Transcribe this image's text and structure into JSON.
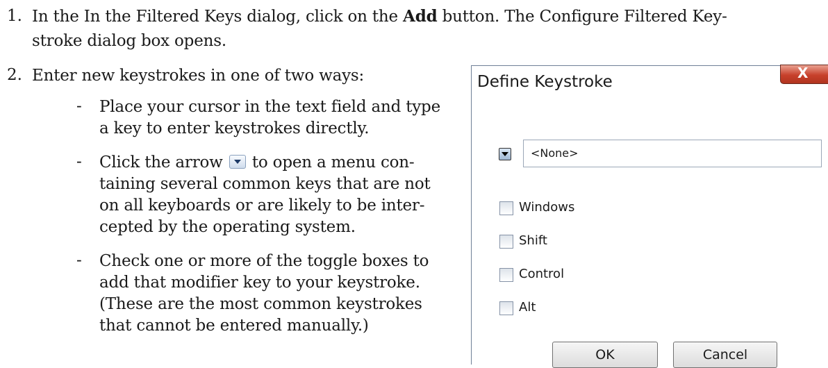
{
  "instructions": {
    "step1": {
      "number": "1.",
      "text_a": "In the In the Filtered Keys dialog, click on the ",
      "bold": "Add",
      "text_b": " button. The Configure Filtered Key-",
      "text_c": "stroke dialog box opens."
    },
    "step2": {
      "number": "2.",
      "text": "Enter new keystrokes in one of two ways:"
    },
    "bullet_marker": "-",
    "bullets": [
      {
        "lines": [
          "Place your cursor in the text field and type",
          "a key to enter keystrokes directly."
        ]
      },
      {
        "line1_a": "Click the arrow ",
        "line1_b": " to open a menu con-",
        "lines": [
          "taining several common keys that are not",
          "on all keyboards or are likely to be inter-",
          "cepted by the operating system."
        ]
      },
      {
        "lines": [
          "Check one or more of the toggle boxes to",
          "add that modifier key to your keystroke.",
          "(These are the most common keystrokes",
          "that cannot be entered manually.)"
        ]
      }
    ]
  },
  "dialog": {
    "title": "Define Keystroke",
    "close_glyph": "X",
    "key_value": "<None>",
    "modifiers": [
      "Windows",
      "Shift",
      "Control",
      "Alt"
    ],
    "ok_label": "OK",
    "cancel_label": "Cancel"
  }
}
